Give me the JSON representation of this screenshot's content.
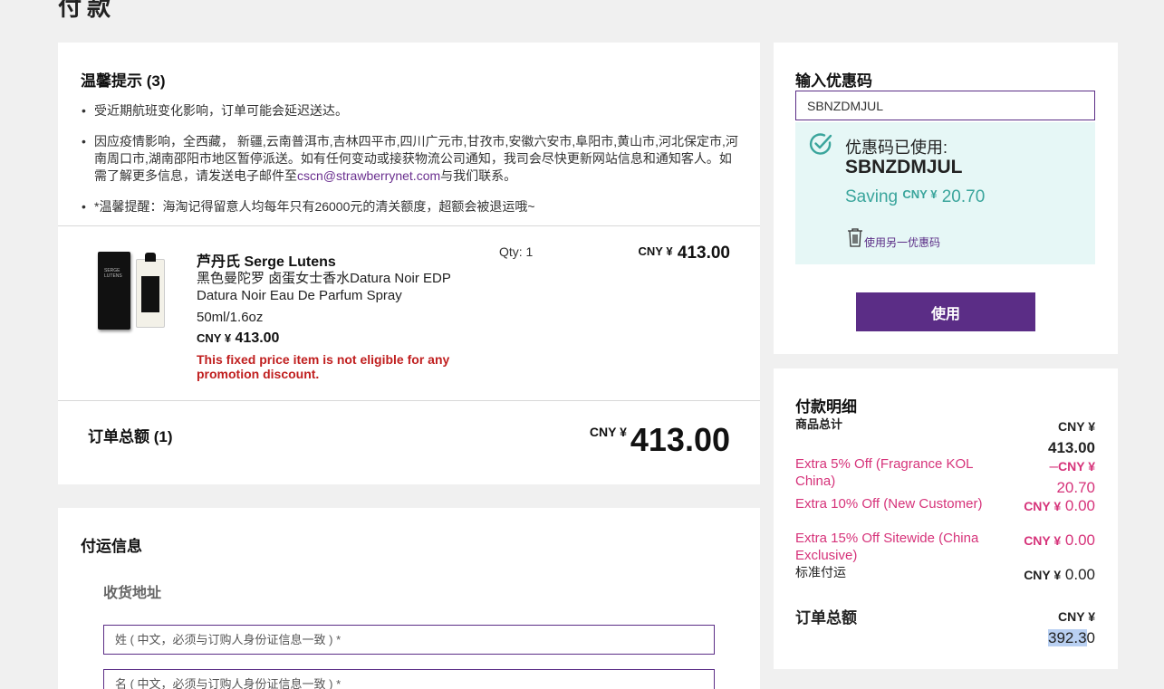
{
  "page": {
    "title": "付款"
  },
  "notices": {
    "title": "温馨提示 (3)",
    "items": [
      "受近期航班变化影响，订单可能会延迟送达。",
      "因应疫情影响，全西藏， 新疆,云南普洱市,吉林四平市,四川广元市,甘孜市,安徽六安市,阜阳市,黄山市,河北保定市,河南周口市,湖南邵阳市地区暂停派送。如有任何变动或接获物流公司通知，我司会尽快更新网站信息和通知客人。如需了解更多信息，请发送电子邮件至",
      "*温馨提醒：海淘记得留意人均每年只有26000元的清关额度，超额会被退运哦~"
    ],
    "email": "cscn@strawberrynet.com",
    "email_suffix": "与我们联系。"
  },
  "product": {
    "brand": "芦丹氏 Serge Lutens",
    "name": "黑色曼陀罗 卤蛋女士香水Datura Noir EDP Datura Noir Eau De Parfum Spray",
    "size": "50ml/1.6oz",
    "currency": "CNY ¥",
    "price": "413.00",
    "warning": "This fixed price item is not eligible for any promotion discount.",
    "qty": "Qty: 1",
    "line_total": "413.00"
  },
  "order": {
    "total_label": "订单总额 (1)",
    "currency": "CNY ¥",
    "total": "413.00"
  },
  "coupon": {
    "title": "输入优惠码",
    "input_value": "SBNZDMJUL",
    "applied_label": "优惠码已使用:",
    "applied_code": "SBNZDMJUL",
    "saving_label": "Saving",
    "saving_currency": "CNY ¥",
    "saving_amount": "20.70",
    "alt_coupon": "使用另一优惠码",
    "apply_button": "使用"
  },
  "summary": {
    "title": "付款明细",
    "subtotal_label": "商品总计",
    "subtotal_currency": "CNY ¥",
    "subtotal": "413.00",
    "discounts": [
      {
        "label": "Extra 5% Off (Fragrance KOL China)",
        "prefix": "–",
        "currency": "CNY ¥",
        "amount": "20.70"
      },
      {
        "label": "Extra 10% Off (New Customer)",
        "prefix": "",
        "currency": "CNY ¥",
        "amount": "0.00"
      },
      {
        "label": "Extra 15% Off Sitewide (China Exclusive)",
        "prefix": "",
        "currency": "CNY ¥",
        "amount": "0.00"
      }
    ],
    "shipping_label": "标准付运",
    "shipping_currency": "CNY ¥",
    "shipping": "0.00",
    "total_label": "订单总额",
    "total_currency": "CNY ¥",
    "total_selected": "392.3",
    "total_rest": "0"
  },
  "shipping": {
    "title": "付运信息",
    "address_title": "收货地址",
    "last_name_placeholder": "姓 ( 中文，必须与订购人身份证信息一致 ) *",
    "first_name_placeholder": "名 ( 中文，必须与订购人身份证信息一致 ) *"
  },
  "colors": {
    "accent": "#5b2d86",
    "discount": "#d6337a",
    "saving": "#3aa59c",
    "warning": "#c01f1f"
  }
}
